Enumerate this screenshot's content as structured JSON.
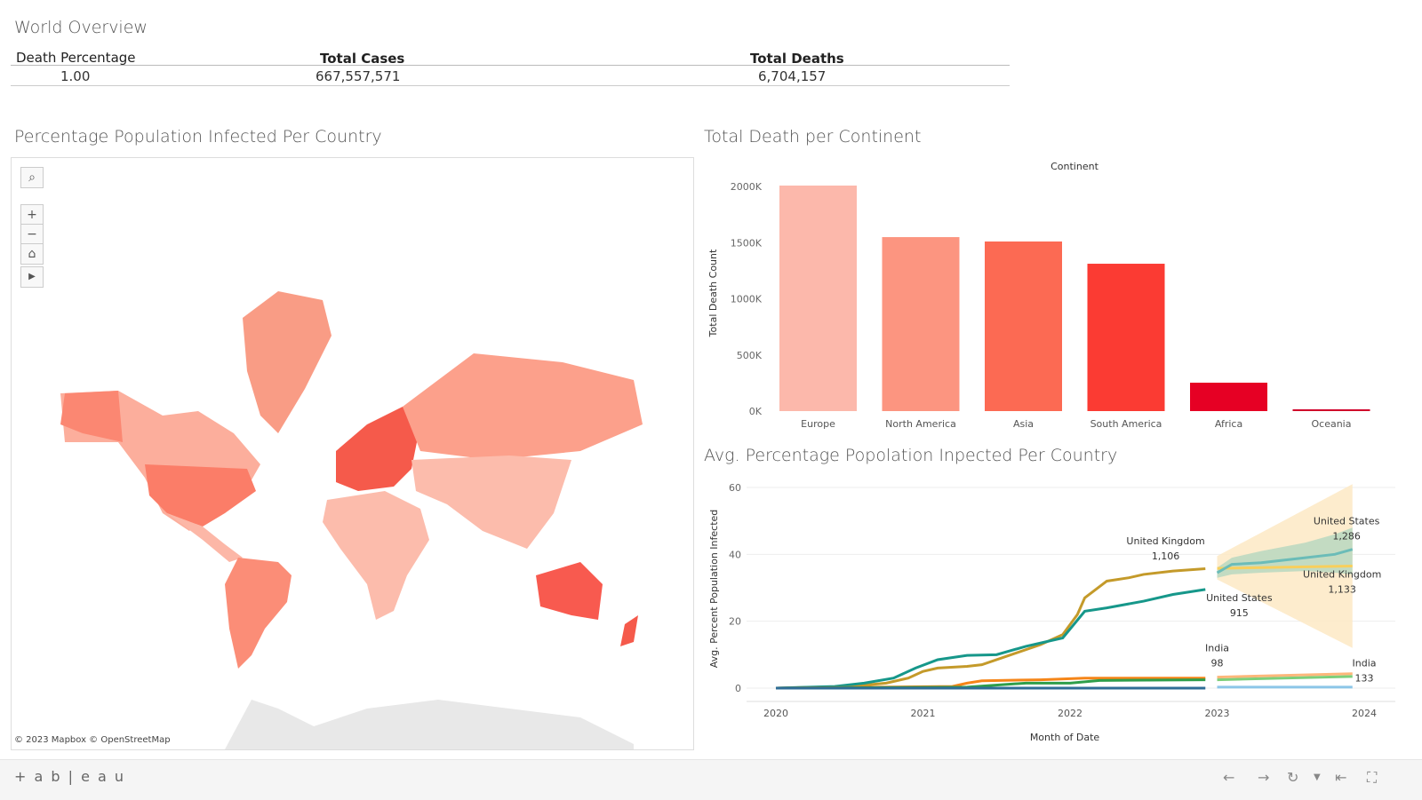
{
  "world_overview": {
    "title": "World Overview",
    "columns": [
      "Death Percentage",
      "Total Cases",
      "Total Deaths"
    ],
    "values": [
      "1.00",
      "667,557,571",
      "6,704,157"
    ]
  },
  "map": {
    "title": "Percentage Population Infected Per Country",
    "attribution": "© 2023 Mapbox  © OpenStreetMap",
    "controls": {
      "search": "search-icon",
      "zoom_in": "+",
      "zoom_out": "−",
      "home": "home-icon",
      "play": "play-icon"
    }
  },
  "bar_chart": {
    "title": "Total Death per Continent"
  },
  "line_chart": {
    "title": "Avg. Percentage Popolation Inpected Per Country"
  },
  "chart_data": [
    {
      "type": "bar",
      "title": "Total Death per Continent",
      "xlabel": "Continent",
      "ylabel": "Total Death Count",
      "categories": [
        "Europe",
        "North America",
        "Asia",
        "South America",
        "Africa",
        "Oceania"
      ],
      "values": [
        2008000,
        1549000,
        1510000,
        1312000,
        253000,
        16000
      ],
      "colors": [
        "#fcb8ab",
        "#fc9580",
        "#fc6a53",
        "#fb3b33",
        "#e60024",
        "#d0002a"
      ],
      "ylim": [
        0,
        2000000
      ],
      "yticks": [
        "0K",
        "500K",
        "1000K",
        "1500K",
        "2000K"
      ],
      "grid": false
    },
    {
      "type": "line",
      "title": "Avg. Percentage Popolation Inpected Per Country",
      "xlabel": "Month of Date",
      "ylabel": "Avg. Percent Population Infected",
      "xlim": [
        2020,
        2024
      ],
      "ylim": [
        0,
        60
      ],
      "xticks": [
        "2020",
        "2021",
        "2022",
        "2023",
        "2024"
      ],
      "yticks": [
        "0",
        "20",
        "40",
        "60"
      ],
      "grid": true,
      "series": [
        {
          "color": "#c49a2a",
          "x": [
            2020,
            2020.5,
            2020.75,
            2020.9,
            2021,
            2021.1,
            2021.3,
            2021.4,
            2021.6,
            2021.8,
            2021.95,
            2022.05,
            2022.1,
            2022.25,
            2022.4,
            2022.5,
            2022.7,
            2022.92
          ],
          "y": [
            0,
            0.5,
            1.5,
            3,
            5,
            6,
            6.5,
            7,
            10,
            13,
            16,
            22,
            27,
            32,
            33,
            34,
            35,
            35.7
          ]
        },
        {
          "color": "#16978a",
          "x": [
            2020,
            2020.4,
            2020.6,
            2020.8,
            2020.95,
            2021.1,
            2021.3,
            2021.5,
            2021.7,
            2021.95,
            2022.1,
            2022.25,
            2022.5,
            2022.7,
            2022.92
          ],
          "y": [
            0,
            0.5,
            1.5,
            3,
            6,
            8.5,
            9.8,
            10,
            12.5,
            15,
            23,
            24,
            26,
            28,
            29.5
          ]
        },
        {
          "color": "#f58518",
          "x": [
            2020,
            2021.2,
            2021.3,
            2021.4,
            2021.8,
            2022.1,
            2022.92
          ],
          "y": [
            0,
            0.5,
            1.5,
            2.2,
            2.5,
            3,
            3
          ]
        },
        {
          "color": "#2e9e4a",
          "x": [
            2020,
            2021.3,
            2021.7,
            2022,
            2022.2,
            2022.92
          ],
          "y": [
            0,
            0.3,
            1.5,
            1.5,
            2.3,
            2.5
          ]
        },
        {
          "color": "#2f6d96",
          "x": [
            2020,
            2022.92
          ],
          "y": [
            0,
            0
          ]
        }
      ],
      "forecast": [
        {
          "color": "#f8cf5c",
          "band": "#fde9c4",
          "x": [
            2023,
            2023.92
          ],
          "y": [
            35.8,
            36.5
          ],
          "lo": [
            32.5,
            12
          ],
          "hi": [
            39.5,
            61
          ]
        },
        {
          "color": "#6bbcb8",
          "band": "#b9d8c0",
          "x": [
            2023,
            2023.1,
            2023.3,
            2023.6,
            2023.8,
            2023.92
          ],
          "y": [
            34.5,
            37,
            37.5,
            39,
            40,
            41.5
          ],
          "lo": [
            33,
            34,
            34.5,
            35,
            34.5,
            34
          ],
          "hi": [
            36,
            39,
            41,
            43.5,
            46,
            48
          ]
        },
        {
          "color": "#fdb77a",
          "x": [
            2023,
            2023.92
          ],
          "y": [
            3.3,
            4.3
          ]
        },
        {
          "color": "#7dcf7a",
          "x": [
            2023,
            2023.92
          ],
          "y": [
            2.5,
            3.5
          ]
        },
        {
          "color": "#8cc6e8",
          "x": [
            2023,
            2023.92
          ],
          "y": [
            0.3,
            0.3
          ]
        }
      ],
      "annotations": [
        {
          "text": "United Kingdom",
          "value": "1,106",
          "x": 2022.65,
          "y": 43
        },
        {
          "text": "United States",
          "value": "1,286",
          "x": 2023.88,
          "y": 49
        },
        {
          "text": "United Kingdom",
          "value": "1,133",
          "x": 2023.85,
          "y": 33
        },
        {
          "text": "United States",
          "value": "915",
          "x": 2023.15,
          "y": 26
        },
        {
          "text": "India",
          "value": "98",
          "x": 2023,
          "y": 11
        },
        {
          "text": "India",
          "value": "133",
          "x": 2024,
          "y": 6.5
        }
      ]
    }
  ],
  "footer": {
    "brand": "+ a b | e a u",
    "icons": [
      "undo-icon",
      "redo-icon",
      "revert-icon",
      "revert-dropdown-icon",
      "reset-icon",
      "fullscreen-icon"
    ]
  }
}
